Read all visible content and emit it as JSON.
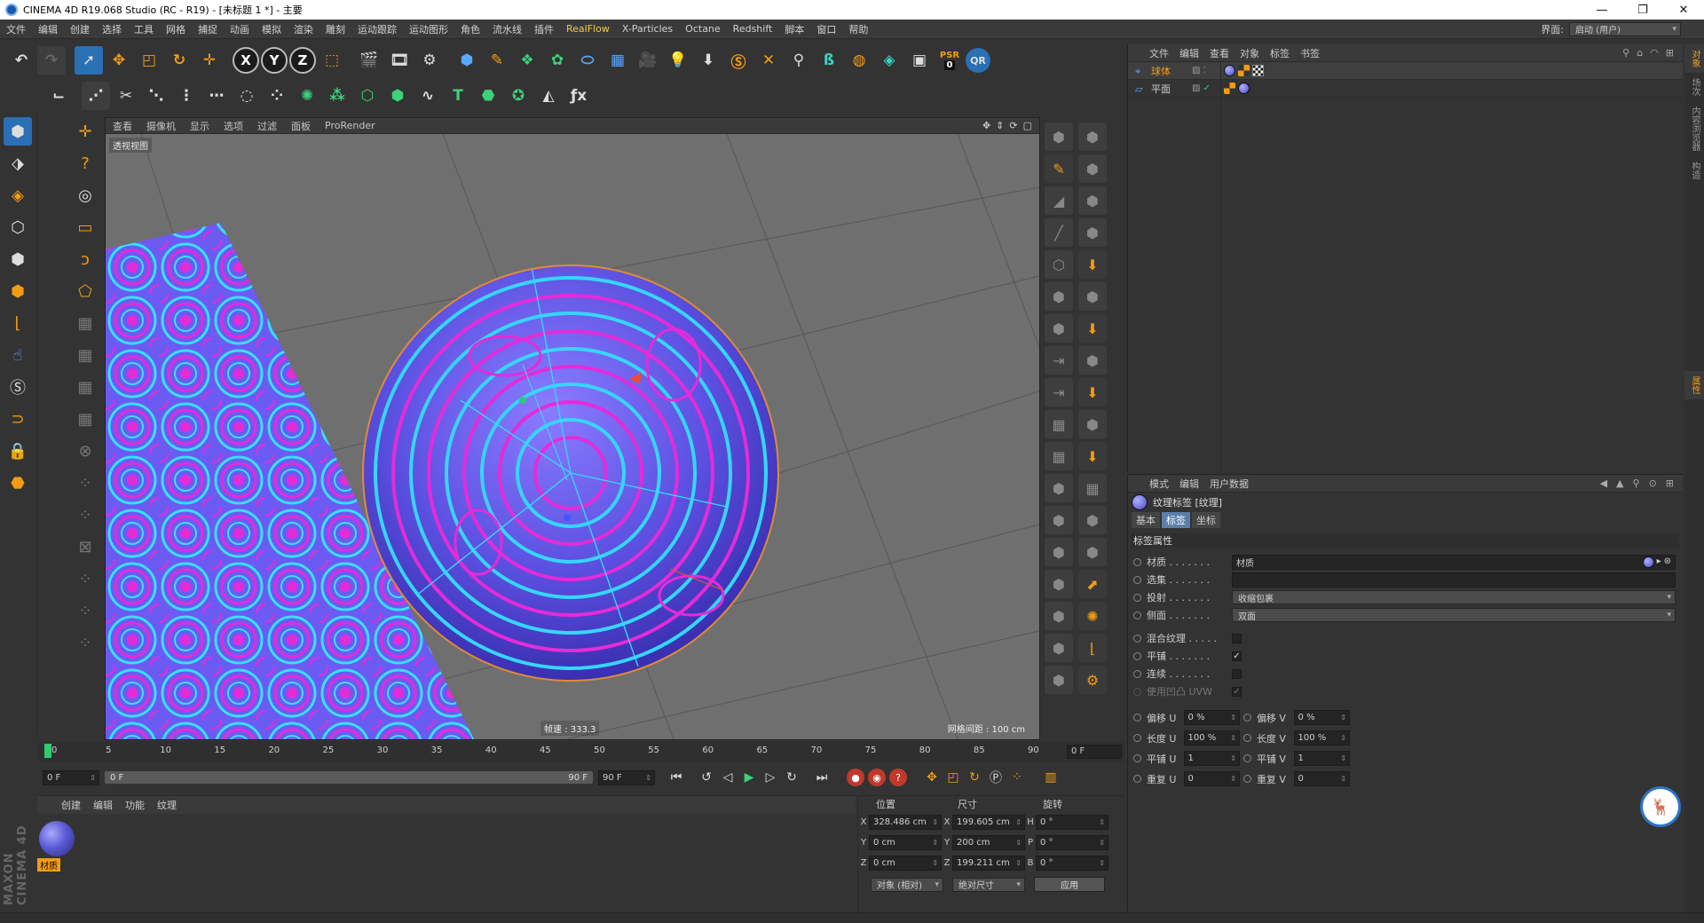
{
  "window": {
    "title": "CINEMA 4D R19.068 Studio (RC - R19) - [未标题 1 *] - 主要",
    "controls": [
      "—",
      "❐",
      "✕"
    ]
  },
  "menubar": {
    "items": [
      "文件",
      "编辑",
      "创建",
      "选择",
      "工具",
      "网格",
      "捕捉",
      "动画",
      "模拟",
      "渲染",
      "雕刻",
      "运动跟踪",
      "运动图形",
      "角色",
      "流水线",
      "插件",
      "RealFlow",
      "X-Particles",
      "Octane",
      "Redshift",
      "脚本",
      "窗口",
      "帮助"
    ],
    "layout_label": "界面:",
    "layout_value": "启动 (用户)"
  },
  "toolbar": {
    "axis_x": "X",
    "axis_y": "Y",
    "axis_z": "Z",
    "psr_label": "PSR",
    "psr_value": "0",
    "qr_label": "QR"
  },
  "viewport": {
    "menu": [
      "查看",
      "摄像机",
      "显示",
      "选项",
      "过滤",
      "面板",
      "ProRender"
    ],
    "label": "透视视图",
    "fps": "帧速 : 333.3",
    "grid": "网格间距 : 100 cm"
  },
  "timeline": {
    "ticks": [
      "0",
      "5",
      "10",
      "15",
      "20",
      "25",
      "30",
      "35",
      "40",
      "45",
      "50",
      "55",
      "60",
      "65",
      "70",
      "75",
      "80",
      "85",
      "90"
    ],
    "current_frame": "0 F",
    "start": "0 F",
    "range_start": "0 F",
    "range_end": "90 F",
    "end": "90 F"
  },
  "material_manager": {
    "menu": [
      "创建",
      "编辑",
      "功能",
      "纹理"
    ],
    "materials": [
      {
        "name": "材质"
      }
    ],
    "brand": "MAXON CINEMA 4D"
  },
  "coordinates": {
    "headers": [
      "位置",
      "尺寸",
      "旋转"
    ],
    "rows": [
      {
        "axis": "X",
        "pos": "328.486 cm",
        "size_axis": "X",
        "size": "199.605 cm",
        "rot_axis": "H",
        "rot": "0 °"
      },
      {
        "axis": "Y",
        "pos": "0 cm",
        "size_axis": "Y",
        "size": "200 cm",
        "rot_axis": "P",
        "rot": "0 °"
      },
      {
        "axis": "Z",
        "pos": "0 cm",
        "size_axis": "Z",
        "size": "199.211 cm",
        "rot_axis": "B",
        "rot": "0 °"
      }
    ],
    "mode": "对象 (相对)",
    "size_mode": "绝对尺寸",
    "apply": "应用"
  },
  "object_manager": {
    "menu": [
      "文件",
      "编辑",
      "查看",
      "对象",
      "标签",
      "书签"
    ],
    "objects": [
      {
        "name": "球体",
        "icon": "sphere-icon"
      },
      {
        "name": "平面",
        "icon": "plane-icon"
      }
    ]
  },
  "attribute_manager": {
    "menu": [
      "模式",
      "编辑",
      "用户数据"
    ],
    "title": "纹理标签 [纹理]",
    "tabs": [
      "基本",
      "标签",
      "坐标"
    ],
    "section": "标签属性",
    "material_label": "材质 . . . . . . .",
    "material_value": "材质",
    "selection_label": "选集 . . . . . . .",
    "projection_label": "投射 . . . . . . .",
    "projection_value": "收缩包裹",
    "side_label": "侧面 . . . . . . .",
    "side_value": "双面",
    "mix_label": "混合纹理 . . . . .",
    "tile_label": "平铺 . . . . . . .",
    "seamless_label": "连续 . . . . . . .",
    "uvw_bump_label": "使用凹凸 UVW",
    "offset_u_label": "偏移 U",
    "offset_u": "0 %",
    "offset_v_label": "偏移 V",
    "offset_v": "0 %",
    "length_u_label": "长度 U",
    "length_u": "100 %",
    "length_v_label": "长度 V",
    "length_v": "100 %",
    "tiles_u_label": "平铺 U",
    "tiles_u": "1",
    "tiles_v_label": "平铺 V",
    "tiles_v": "1",
    "repeat_u_label": "重复 U",
    "repeat_u": "0",
    "repeat_v_label": "重复 V",
    "repeat_v": "0",
    "checkmark": "✓"
  },
  "side_tabs": {
    "top": [
      "对象",
      "场次",
      "内容浏览器",
      "构造"
    ],
    "bottom": [
      "属性"
    ]
  },
  "colors": {
    "accent_orange": "#f39c12",
    "active_blue": "#2b6fb5",
    "psychedelic_purple": "#6b4bff",
    "psychedelic_magenta": "#e52bd8",
    "psychedelic_cyan": "#38e0ff"
  }
}
